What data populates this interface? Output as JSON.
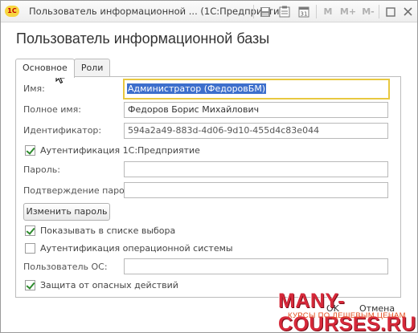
{
  "window": {
    "logo": "1С",
    "title": "Пользователь информационной ... (1С:Предприятие)",
    "toolbar": {
      "memo_m": "M",
      "memo_m_plus": "M+",
      "memo_m_minus": "M-",
      "minimize": "—",
      "restore": "▭",
      "close": "×"
    }
  },
  "form": {
    "title": "Пользователь информационной базы"
  },
  "tabs": [
    {
      "label": "Основное",
      "active": true
    },
    {
      "label": "Роли",
      "active": false
    }
  ],
  "fields": {
    "name_label": "Имя:",
    "name_value": "Администратор (ФедоровБМ)",
    "fullname_label": "Полное имя:",
    "fullname_value": "Федоров Борис Михайлович",
    "id_label": "Идентификатор:",
    "id_value": "594a2a49-883d-4d06-9d10-455d4c83e044",
    "auth1c_label": "Аутентификация 1С:Предприятие",
    "auth1c_checked": true,
    "password_label": "Пароль:",
    "password_value": "",
    "confirm_label": "Подтверждение пароля:",
    "confirm_value": "",
    "change_password_button": "Изменить пароль",
    "show_in_list_label": "Показывать в списке выбора",
    "show_in_list_checked": true,
    "os_auth_label": "Аутентификация операционной системы",
    "os_auth_checked": false,
    "os_user_label": "Пользователь ОС:",
    "os_user_value": "",
    "protection_label": "Защита от опасных действий",
    "protection_checked": true
  },
  "footer": {
    "ok_button": "OK",
    "cancel_button": "Отмена"
  },
  "watermark": {
    "main": "MANY-COURSES.RU",
    "sub": "КУРСЫ ПО ДЕШЕВЫМ ЦЕНАМ"
  },
  "colors": {
    "focus_border": "#e8c840",
    "selection": "#3d6fcc",
    "check": "#2d8a2d",
    "watermark": "#d6293a"
  }
}
